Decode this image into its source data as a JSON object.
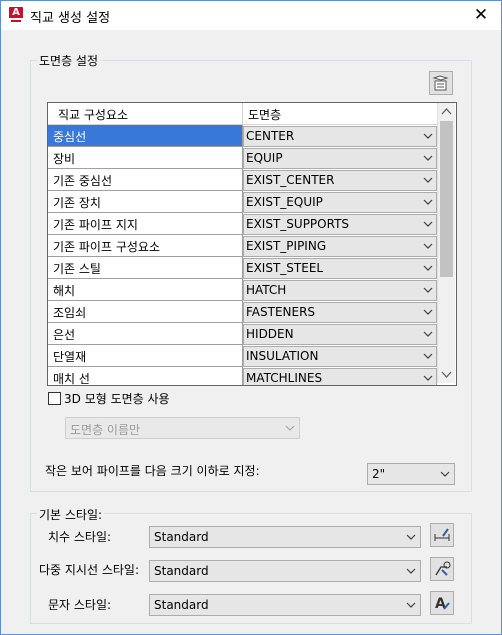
{
  "window": {
    "title": "직교 생성 설정",
    "app_icon": "autocad-logo",
    "close_glyph": "✕"
  },
  "layer_group": {
    "legend": "도면층 설정",
    "settings_icon": "layer-properties-icon",
    "columns": [
      "직교 구성요소",
      "도면층"
    ],
    "rows": [
      {
        "component": "중심선",
        "layer": "CENTER",
        "selected": true
      },
      {
        "component": "장비",
        "layer": "EQUIP"
      },
      {
        "component": "기존 중심선",
        "layer": "EXIST_CENTER"
      },
      {
        "component": "기존 장치",
        "layer": "EXIST_EQUIP"
      },
      {
        "component": "기존 파이프 지지",
        "layer": "EXIST_SUPPORTS"
      },
      {
        "component": "기존 파이프 구성요소",
        "layer": "EXIST_PIPING"
      },
      {
        "component": "기존 스틸",
        "layer": "EXIST_STEEL"
      },
      {
        "component": "해치",
        "layer": "HATCH"
      },
      {
        "component": "조임쇠",
        "layer": "FASTENERS"
      },
      {
        "component": "은선",
        "layer": "HIDDEN"
      },
      {
        "component": "단열재",
        "layer": "INSULATION"
      },
      {
        "component": "매치 선",
        "layer": "MATCHLINES"
      }
    ],
    "use_3d_layers_label": "3D 모형 도면층 사용",
    "use_3d_layers_checked": false,
    "layer_name_only": "도면층 이름만",
    "small_bore_label": "작은 보어 파이프를 다음 크기 이하로 지정:",
    "small_bore_value": "2\""
  },
  "style_group": {
    "legend": "기본 스타일:",
    "dimension_label": "치수 스타일:",
    "dimension_value": "Standard",
    "multileader_label": "다중 지시선 스타일:",
    "multileader_value": "Standard",
    "text_label": "문자 스타일:",
    "text_value": "Standard"
  },
  "colors": {
    "selection": "#3778d8",
    "window_border": "#5c8fd6",
    "app_icon": "#c8102e"
  }
}
